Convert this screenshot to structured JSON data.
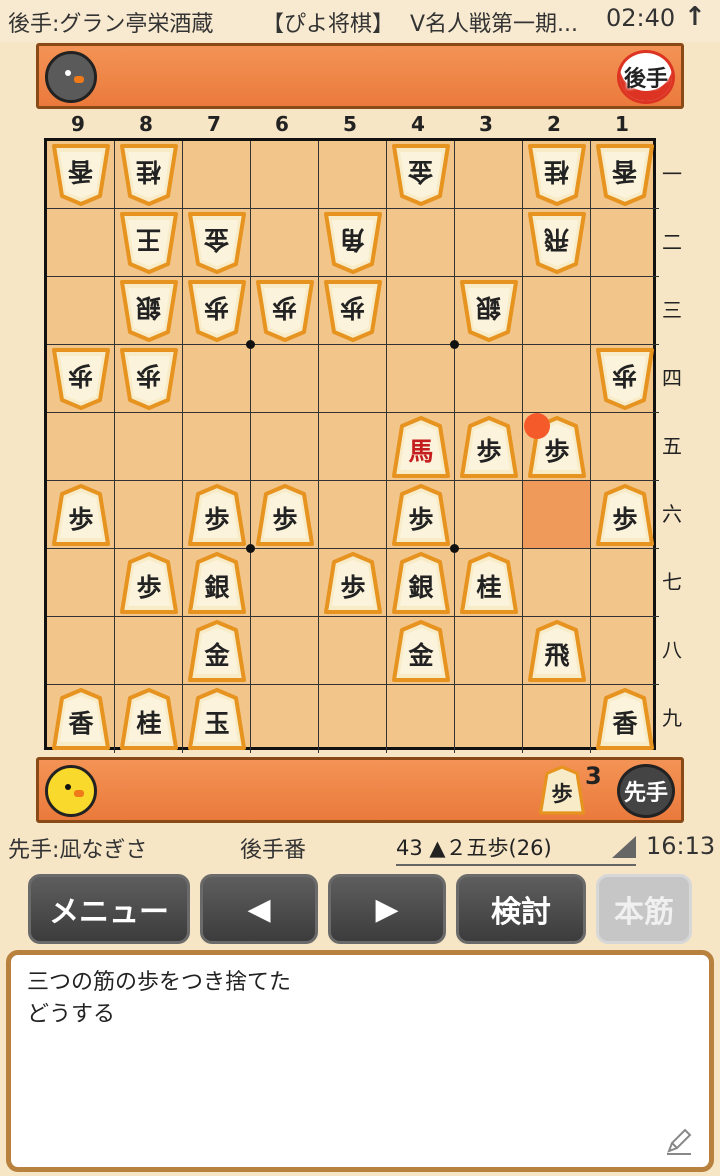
{
  "status": {
    "gote_player": "後手:グラン亭栄酒蔵",
    "app": "【ぴよ将棋】",
    "title": "V名人戦第一期...",
    "clock": "02:40",
    "arrow_icon": "up-arrow-icon"
  },
  "top_stand": {
    "side_label": "後手",
    "avatar_icon": "black-chick-icon"
  },
  "bottom_stand": {
    "side_label": "先手",
    "avatar_icon": "yellow-chick-icon",
    "hand": [
      {
        "piece": "歩",
        "count": "3"
      }
    ]
  },
  "file_labels": [
    "9",
    "8",
    "7",
    "6",
    "5",
    "4",
    "3",
    "2",
    "1"
  ],
  "rank_labels": [
    "一",
    "二",
    "三",
    "四",
    "五",
    "六",
    "七",
    "八",
    "九"
  ],
  "board": {
    "highlight_square": {
      "file": 2,
      "rank": 6
    },
    "last_move_marker": {
      "file": 2,
      "rank": 5,
      "color": "#f45a2a"
    },
    "pieces": [
      {
        "file": 9,
        "rank": 1,
        "piece": "香",
        "side": "gote"
      },
      {
        "file": 8,
        "rank": 1,
        "piece": "桂",
        "side": "gote"
      },
      {
        "file": 4,
        "rank": 1,
        "piece": "金",
        "side": "gote"
      },
      {
        "file": 2,
        "rank": 1,
        "piece": "桂",
        "side": "gote"
      },
      {
        "file": 1,
        "rank": 1,
        "piece": "香",
        "side": "gote"
      },
      {
        "file": 8,
        "rank": 2,
        "piece": "王",
        "side": "gote"
      },
      {
        "file": 7,
        "rank": 2,
        "piece": "金",
        "side": "gote"
      },
      {
        "file": 5,
        "rank": 2,
        "piece": "角",
        "side": "gote"
      },
      {
        "file": 2,
        "rank": 2,
        "piece": "飛",
        "side": "gote"
      },
      {
        "file": 8,
        "rank": 3,
        "piece": "銀",
        "side": "gote"
      },
      {
        "file": 7,
        "rank": 3,
        "piece": "歩",
        "side": "gote"
      },
      {
        "file": 6,
        "rank": 3,
        "piece": "歩",
        "side": "gote"
      },
      {
        "file": 5,
        "rank": 3,
        "piece": "歩",
        "side": "gote"
      },
      {
        "file": 3,
        "rank": 3,
        "piece": "銀",
        "side": "gote"
      },
      {
        "file": 9,
        "rank": 4,
        "piece": "歩",
        "side": "gote"
      },
      {
        "file": 8,
        "rank": 4,
        "piece": "歩",
        "side": "gote"
      },
      {
        "file": 1,
        "rank": 4,
        "piece": "歩",
        "side": "gote"
      },
      {
        "file": 4,
        "rank": 5,
        "piece": "馬",
        "side": "sente",
        "promoted": true
      },
      {
        "file": 3,
        "rank": 5,
        "piece": "歩",
        "side": "sente"
      },
      {
        "file": 2,
        "rank": 5,
        "piece": "歩",
        "side": "sente"
      },
      {
        "file": 9,
        "rank": 6,
        "piece": "歩",
        "side": "sente"
      },
      {
        "file": 7,
        "rank": 6,
        "piece": "歩",
        "side": "sente"
      },
      {
        "file": 6,
        "rank": 6,
        "piece": "歩",
        "side": "sente"
      },
      {
        "file": 4,
        "rank": 6,
        "piece": "歩",
        "side": "sente"
      },
      {
        "file": 1,
        "rank": 6,
        "piece": "歩",
        "side": "sente"
      },
      {
        "file": 8,
        "rank": 7,
        "piece": "歩",
        "side": "sente"
      },
      {
        "file": 7,
        "rank": 7,
        "piece": "銀",
        "side": "sente"
      },
      {
        "file": 5,
        "rank": 7,
        "piece": "歩",
        "side": "sente"
      },
      {
        "file": 4,
        "rank": 7,
        "piece": "銀",
        "side": "sente"
      },
      {
        "file": 3,
        "rank": 7,
        "piece": "桂",
        "side": "sente"
      },
      {
        "file": 7,
        "rank": 8,
        "piece": "金",
        "side": "sente"
      },
      {
        "file": 4,
        "rank": 8,
        "piece": "金",
        "side": "sente"
      },
      {
        "file": 2,
        "rank": 8,
        "piece": "飛",
        "side": "sente"
      },
      {
        "file": 9,
        "rank": 9,
        "piece": "香",
        "side": "sente"
      },
      {
        "file": 8,
        "rank": 9,
        "piece": "桂",
        "side": "sente"
      },
      {
        "file": 7,
        "rank": 9,
        "piece": "玉",
        "side": "sente"
      },
      {
        "file": 1,
        "rank": 9,
        "piece": "香",
        "side": "sente"
      }
    ]
  },
  "info": {
    "sente_player": "先手:凪なぎさ",
    "turn": "後手番",
    "move": "43 ▲２五歩(26)",
    "time": "16:13"
  },
  "toolbar": {
    "menu": "メニュー",
    "prev": "◀",
    "next": "▶",
    "analyze": "検討",
    "mainline": "本筋"
  },
  "comment": {
    "line1": "三つの筋の歩をつき捨てた",
    "line2": "どうする",
    "edit_icon": "pencil-icon"
  }
}
